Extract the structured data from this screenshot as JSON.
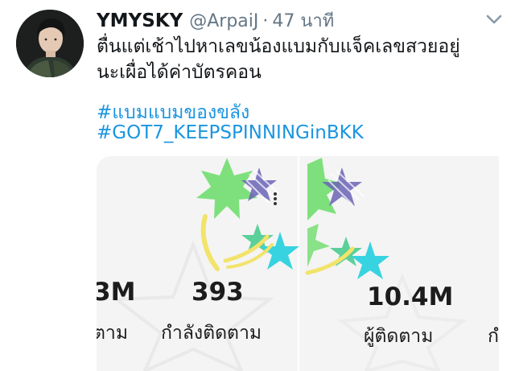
{
  "tweet": {
    "display_name": "YMYSKY",
    "handle": "@ArpaiJ",
    "separator": "·",
    "time": "47 นาที",
    "text_line1": "ตื่นแต่เช้าไปหาเลขน้องแบมกับแจ็คเลขสวยอยู่",
    "text_line2": "นะเผื่อได้ค่าบัตรคอน",
    "hashtag1": "#แบมแบมของขลัง",
    "hashtag2": "#GOT7_KEEPSPINNINGinBKK"
  },
  "media": {
    "left": {
      "stat1_value": "3M",
      "stat1_label": "ตาม",
      "stat2_value": "393",
      "stat2_label": "กำลังติดตาม"
    },
    "right": {
      "stat_value": "10.4M",
      "stat_label": "ผู้ติดตาม",
      "stat_next_label": "กำ"
    }
  },
  "colors": {
    "hashtag": "#1b95e0",
    "secondary_text": "#657786",
    "star_green": "#7ee07c",
    "star_cyan": "#38d3e0",
    "star_purple": "#6a63b5",
    "stroke_yellow": "#f2e36b"
  },
  "icons": {
    "caret": "chevron-down-icon",
    "avatar": "profile-avatar",
    "more": "more-vertical-icon"
  }
}
